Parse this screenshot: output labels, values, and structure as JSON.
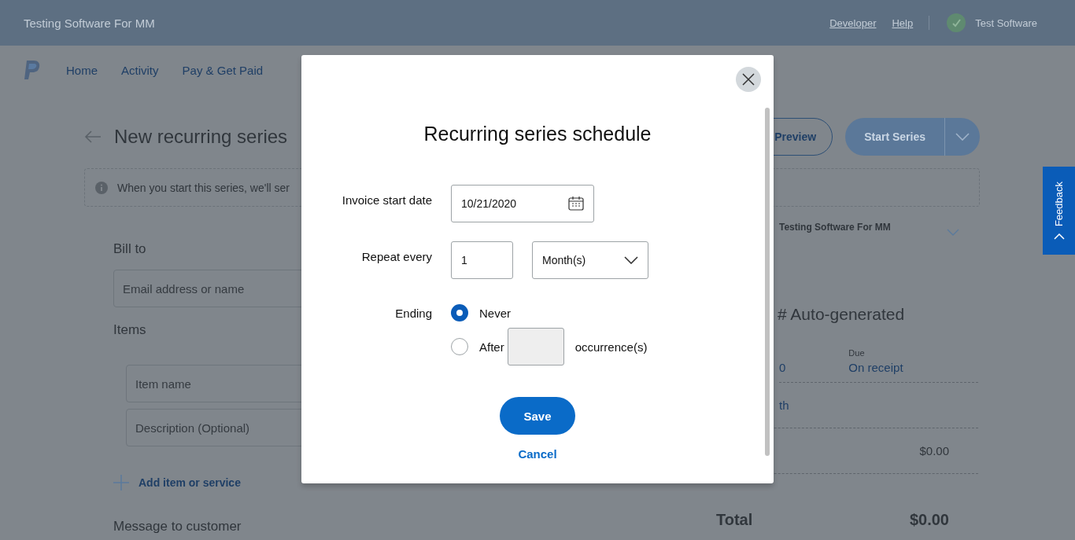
{
  "topbar": {
    "brand": "Testing Software For MM",
    "links": [
      "Developer",
      "Help"
    ],
    "user": "Test Software"
  },
  "nav": {
    "items": [
      "Home",
      "Activity",
      "Pay & Get Paid"
    ]
  },
  "page": {
    "title": "New recurring series",
    "notice": "When you start this series, we'll ser",
    "preview_button": "Preview",
    "start_button": "Start Series",
    "bill_to": "Bill to",
    "email_placeholder": "Email address or name",
    "items_label": "Items",
    "item_name_placeholder": "Item name",
    "description_placeholder": "Description (Optional)",
    "add_item": "Add item or service",
    "message_label": "Message to customer",
    "business_name": "Testing Software For MM",
    "invoice_number": "# Auto-generated",
    "date_value": "0",
    "due_label": "Due",
    "due_value": "On receipt",
    "row_text": "th",
    "subtotal_value": "$0.00",
    "total_label": "Total",
    "total_value": "$0.00"
  },
  "feedback": "Feedback",
  "modal": {
    "title": "Recurring series schedule",
    "start_label": "Invoice start date",
    "start_value": "10/21/2020",
    "repeat_label": "Repeat every",
    "repeat_value": "1",
    "repeat_unit": "Month(s)",
    "ending_label": "Ending",
    "options": [
      {
        "label": "Never",
        "selected": true
      },
      {
        "label": "After",
        "selected": false
      }
    ],
    "occurrences": {
      "suffix": "occurrence(s)",
      "disabled": true
    },
    "save": "Save",
    "cancel": "Cancel"
  }
}
